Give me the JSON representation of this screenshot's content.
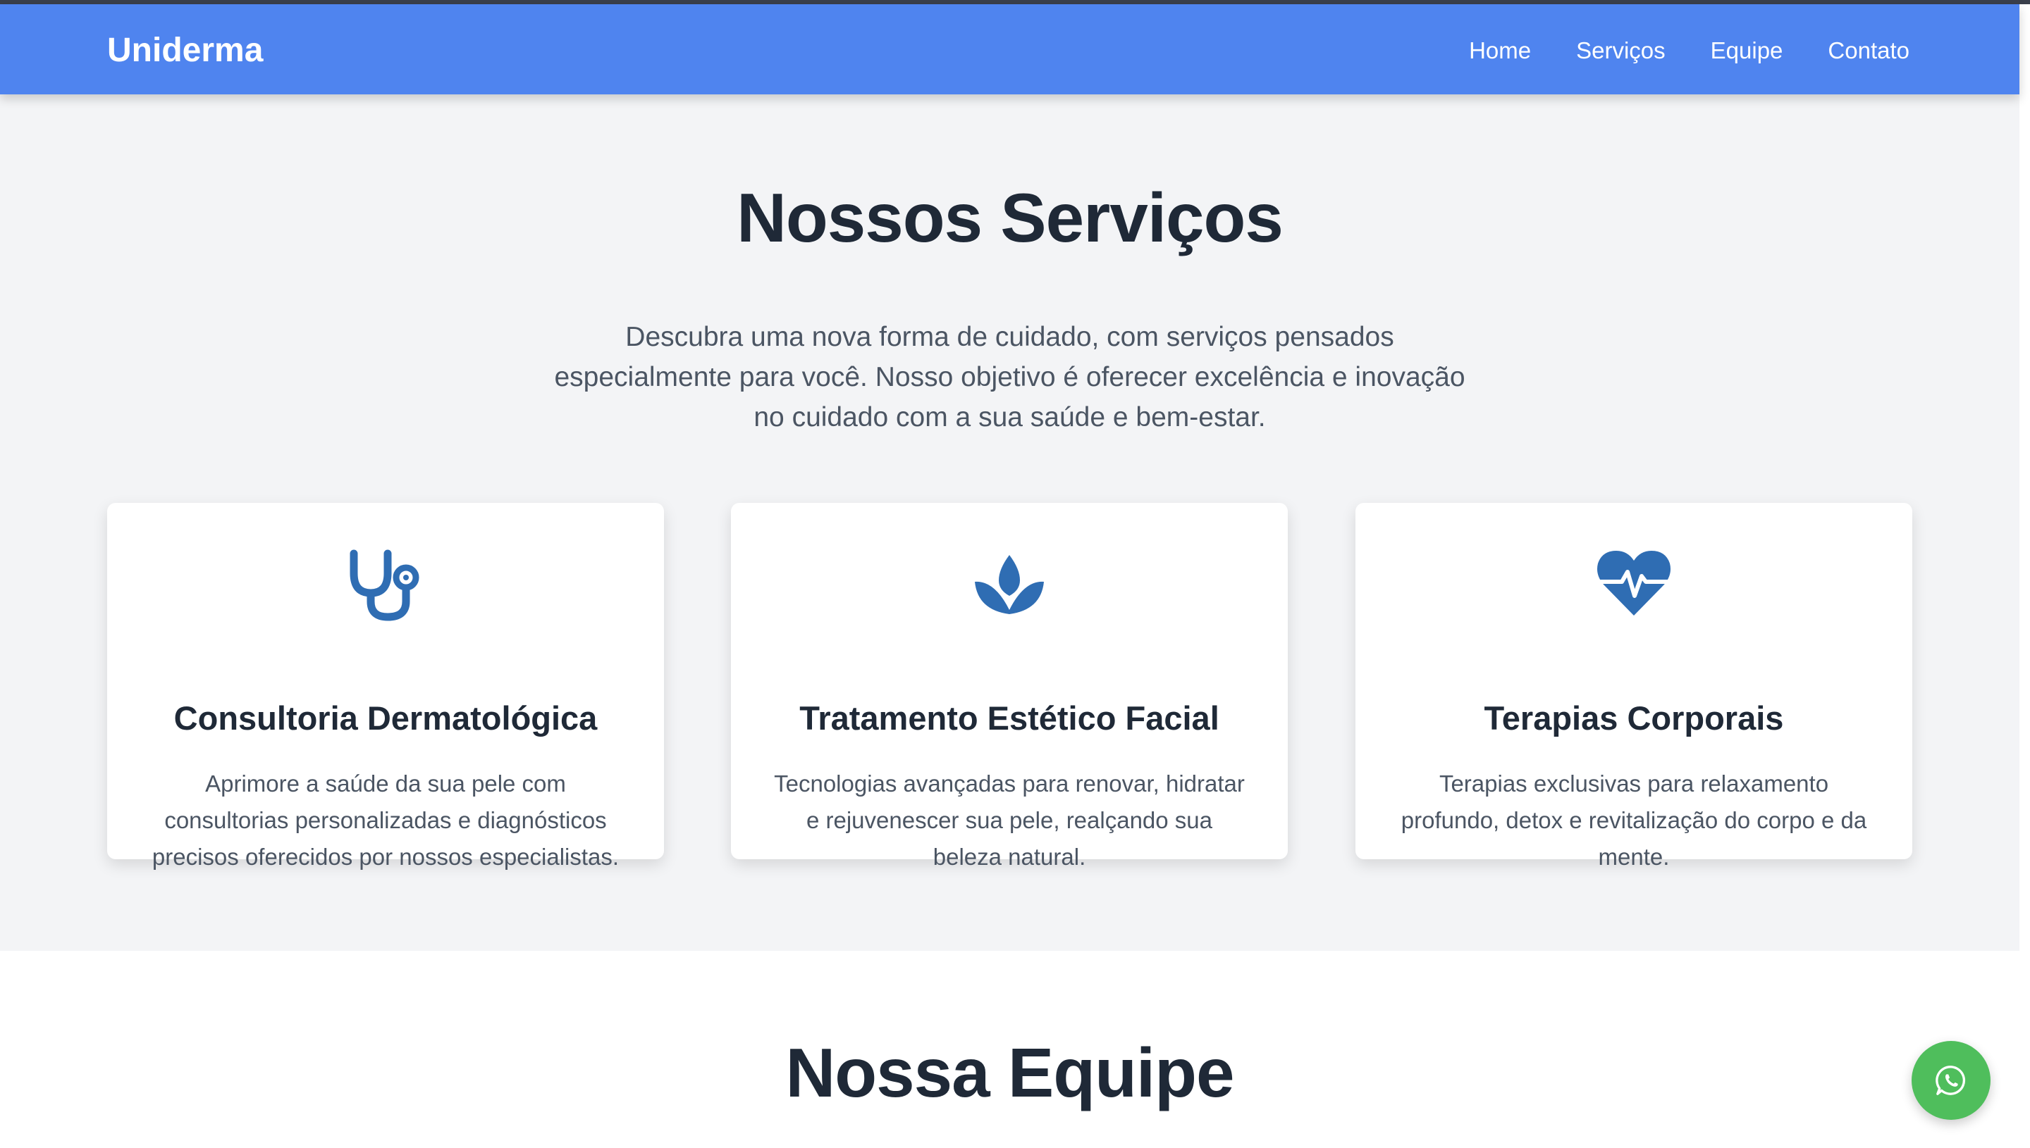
{
  "header": {
    "brand": "Uniderma",
    "nav": [
      {
        "label": "Home"
      },
      {
        "label": "Serviços"
      },
      {
        "label": "Equipe"
      },
      {
        "label": "Contato"
      }
    ]
  },
  "services": {
    "title": "Nossos Serviços",
    "lead_lines": [
      "Descubra uma nova forma de cuidado, com serviços pensados",
      "especialmente para você. Nosso objetivo é oferecer excelência e inovação",
      "no cuidado com a sua saúde e bem-estar."
    ],
    "cards": [
      {
        "icon": "stethoscope-icon",
        "title": "Consultoria Dermatológica",
        "desc_lines": [
          "Aprimore a saúde da sua pele com",
          "consultorias personalizadas e diagnósticos",
          "precisos oferecidos por nossos especialistas."
        ]
      },
      {
        "icon": "lotus-icon",
        "title": "Tratamento Estético Facial",
        "desc_lines": [
          "Tecnologias avançadas para renovar, hidratar",
          "e rejuvenescer sua pele, realçando sua",
          "beleza natural."
        ]
      },
      {
        "icon": "heart-pulse-icon",
        "title": "Terapias Corporais",
        "desc_lines": [
          "Terapias exclusivas para relaxamento",
          "profundo, detox e revitalização do corpo e da",
          "mente."
        ]
      }
    ]
  },
  "team": {
    "title": "Nossa Equipe"
  },
  "floating": {
    "icon": "whatsapp-icon"
  },
  "colors": {
    "navbar": "#4f84ef",
    "icon_blue": "#2f6db3",
    "whatsapp_green": "#4fbe5c",
    "section_bg": "#f3f4f6"
  }
}
